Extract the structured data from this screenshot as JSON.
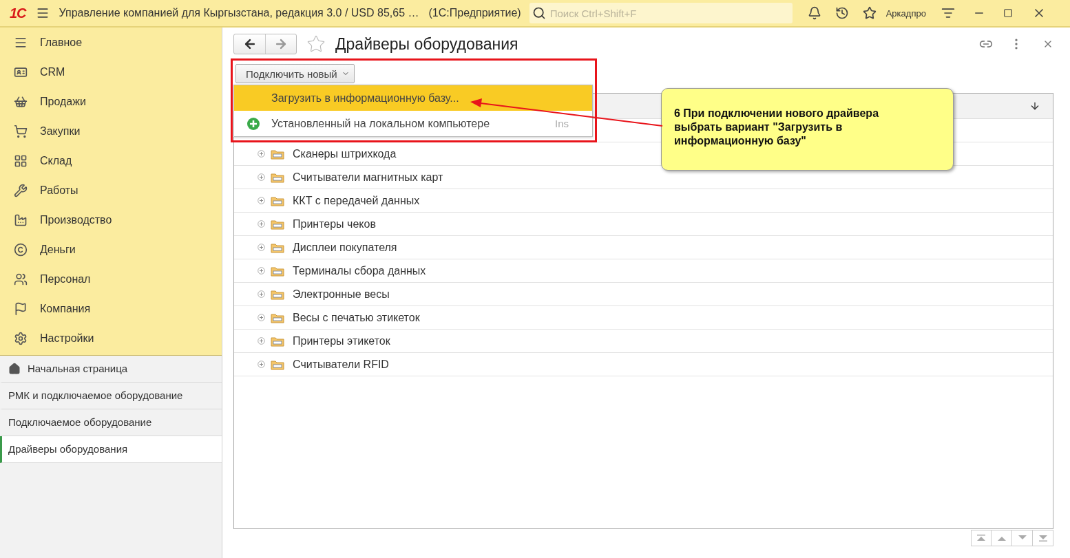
{
  "header": {
    "logo": "1С",
    "title": "Управление компанией для Кыргызстана, редакция 3.0 / USD 85,65 …",
    "app": "(1С:Предприятие)",
    "search": {
      "placeholder": "Поиск Ctrl+Shift+F"
    },
    "user": "Аркадпро"
  },
  "sections": [
    {
      "label": "Главное"
    },
    {
      "label": "CRM"
    },
    {
      "label": "Продажи"
    },
    {
      "label": "Закупки"
    },
    {
      "label": "Склад"
    },
    {
      "label": "Работы"
    },
    {
      "label": "Производство"
    },
    {
      "label": "Деньги"
    },
    {
      "label": "Персонал"
    },
    {
      "label": "Компания"
    },
    {
      "label": "Настройки"
    }
  ],
  "open_pages": [
    {
      "label": "Начальная страница",
      "kind": "home",
      "selected": false
    },
    {
      "label": "РМК и подключаемое оборудование",
      "kind": "page",
      "selected": false
    },
    {
      "label": "Подключаемое оборудование",
      "kind": "page",
      "selected": false
    },
    {
      "label": "Драйверы оборудования",
      "kind": "page",
      "selected": true
    }
  ],
  "form": {
    "title": "Драйверы оборудования",
    "favorite": false,
    "connect_button": "Подключить новый",
    "menu": [
      {
        "label": "Загрузить в информационную базу...",
        "selected": true,
        "kind": "plain"
      },
      {
        "label": "Установленный на локальном компьютере",
        "selected": false,
        "kind": "add",
        "shortcut": "Ins"
      }
    ],
    "rows": [
      {
        "label": "Сканеры штрихкода",
        "expanded": false
      },
      {
        "label": "Считыватели магнитных карт",
        "expanded": false
      },
      {
        "label": "ККТ с передачей данных",
        "expanded": false
      },
      {
        "label": "Принтеры чеков",
        "expanded": false
      },
      {
        "label": "Дисплеи покупателя",
        "expanded": false
      },
      {
        "label": "Терминалы сбора данных",
        "expanded": false
      },
      {
        "label": "Электронные весы",
        "expanded": false
      },
      {
        "label": "Весы с печатью этикеток",
        "expanded": false
      },
      {
        "label": "Принтеры этикеток",
        "expanded": false
      },
      {
        "label": "Считыватели RFID",
        "expanded": false
      }
    ]
  },
  "callout": {
    "text": "6 При подключении нового драйвера выбрать вариант \"Загрузить в информационную базу\""
  }
}
